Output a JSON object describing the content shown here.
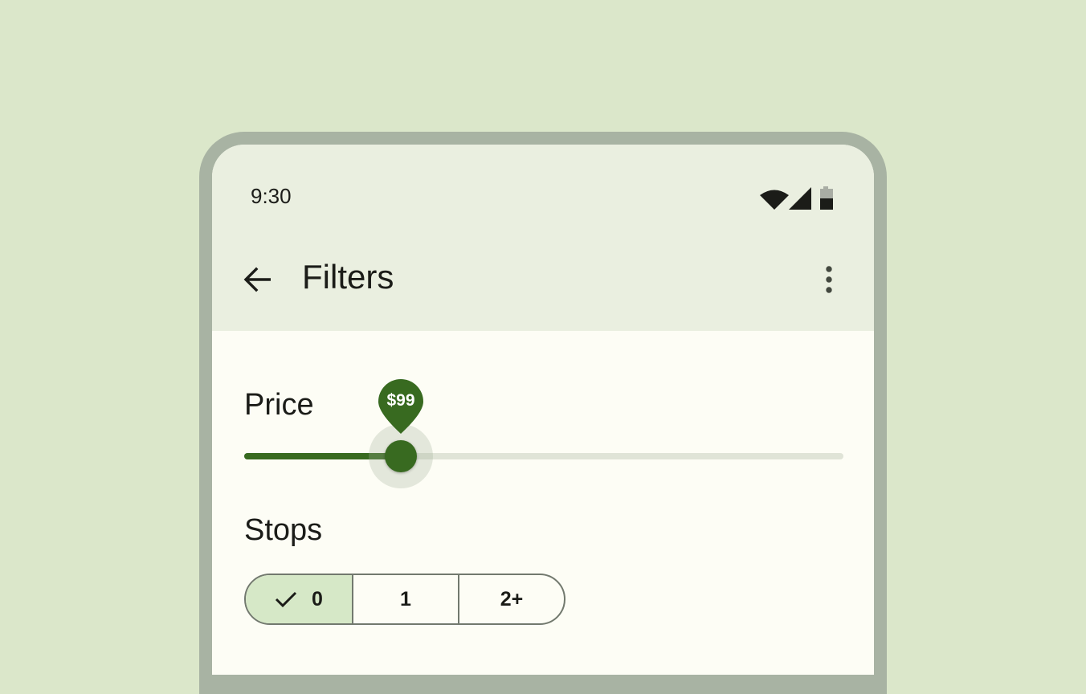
{
  "status_bar": {
    "time": "9:30",
    "icons": [
      "wifi-icon",
      "cellular-signal-icon",
      "battery-icon"
    ]
  },
  "app_bar": {
    "title": "Filters",
    "back_icon": "arrow-back-icon",
    "menu_icon": "more-vert-icon"
  },
  "price": {
    "label": "Price",
    "value_label": "$99",
    "slider_fraction": 0.262
  },
  "stops": {
    "label": "Stops",
    "options": [
      {
        "label": "0",
        "selected": true
      },
      {
        "label": "1",
        "selected": false
      },
      {
        "label": "2+",
        "selected": false
      }
    ]
  },
  "colors": {
    "background": "#dbe7ca",
    "device_frame": "#a8b3a3",
    "top_bar": "#eaefe0",
    "surface": "#fdfdf5",
    "primary": "#386a20",
    "selected_segment": "#d6e8c7",
    "outline": "#72796e"
  }
}
